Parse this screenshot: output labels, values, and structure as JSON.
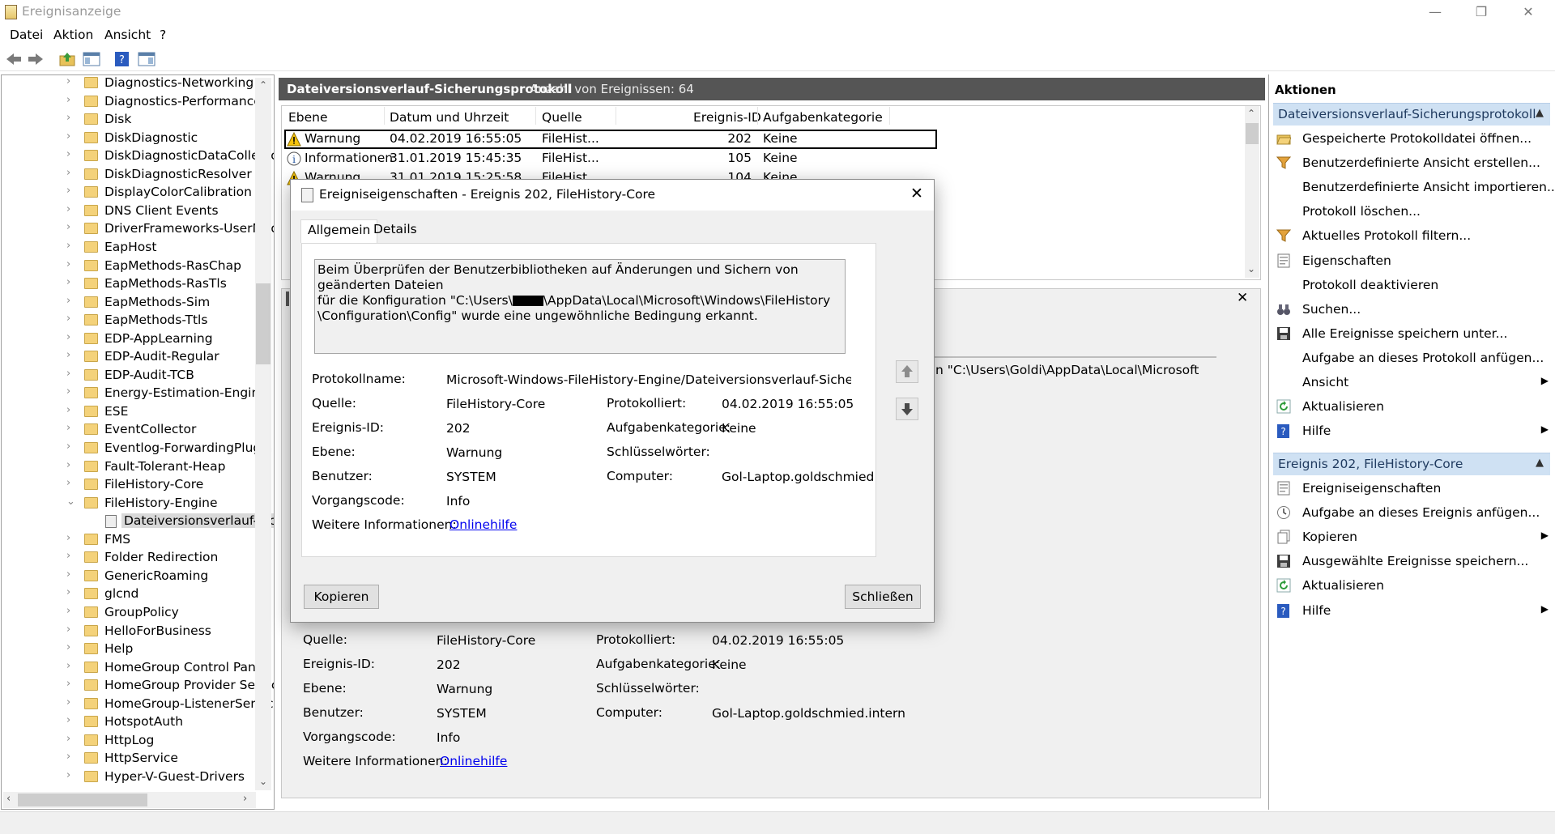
{
  "window": {
    "title": "Ereignisanzeige",
    "controls": {
      "minimize": "—",
      "restore": "❐",
      "close": "✕"
    }
  },
  "menu": [
    "Datei",
    "Aktion",
    "Ansicht",
    "?"
  ],
  "tree": {
    "items": [
      {
        "label": "Diagnostics-Networking",
        "chevron": "›"
      },
      {
        "label": "Diagnostics-Performance",
        "chevron": "›"
      },
      {
        "label": "Disk",
        "chevron": "›"
      },
      {
        "label": "DiskDiagnostic",
        "chevron": "›"
      },
      {
        "label": "DiskDiagnosticDataCollector",
        "chevron": "›"
      },
      {
        "label": "DiskDiagnosticResolver",
        "chevron": "›"
      },
      {
        "label": "DisplayColorCalibration",
        "chevron": "›"
      },
      {
        "label": "DNS Client Events",
        "chevron": "›"
      },
      {
        "label": "DriverFrameworks-UserMode",
        "chevron": "›"
      },
      {
        "label": "EapHost",
        "chevron": "›"
      },
      {
        "label": "EapMethods-RasChap",
        "chevron": "›"
      },
      {
        "label": "EapMethods-RasTls",
        "chevron": "›"
      },
      {
        "label": "EapMethods-Sim",
        "chevron": "›"
      },
      {
        "label": "EapMethods-Ttls",
        "chevron": "›"
      },
      {
        "label": "EDP-AppLearning",
        "chevron": "›"
      },
      {
        "label": "EDP-Audit-Regular",
        "chevron": "›"
      },
      {
        "label": "EDP-Audit-TCB",
        "chevron": "›"
      },
      {
        "label": "Energy-Estimation-Engine",
        "chevron": "›"
      },
      {
        "label": "ESE",
        "chevron": "›"
      },
      {
        "label": "EventCollector",
        "chevron": "›"
      },
      {
        "label": "Eventlog-ForwardingPlugin",
        "chevron": "›"
      },
      {
        "label": "Fault-Tolerant-Heap",
        "chevron": "›"
      },
      {
        "label": "FileHistory-Core",
        "chevron": "›"
      },
      {
        "label": "FileHistory-Engine",
        "chevron": "⌄"
      },
      {
        "label": "Dateiversionsverlauf-Sich",
        "chevron": ""
      },
      {
        "label": "FMS",
        "chevron": "›"
      },
      {
        "label": "Folder Redirection",
        "chevron": "›"
      },
      {
        "label": "GenericRoaming",
        "chevron": "›"
      },
      {
        "label": "glcnd",
        "chevron": "›"
      },
      {
        "label": "GroupPolicy",
        "chevron": "›"
      },
      {
        "label": "HelloForBusiness",
        "chevron": "›"
      },
      {
        "label": "Help",
        "chevron": "›"
      },
      {
        "label": "HomeGroup Control Panel",
        "chevron": "›"
      },
      {
        "label": "HomeGroup Provider Service",
        "chevron": "›"
      },
      {
        "label": "HomeGroup-ListenerService",
        "chevron": "›"
      },
      {
        "label": "HotspotAuth",
        "chevron": "›"
      },
      {
        "label": "HttpLog",
        "chevron": "›"
      },
      {
        "label": "HttpService",
        "chevron": "›"
      },
      {
        "label": "Hyper-V-Guest-Drivers",
        "chevron": "›"
      }
    ]
  },
  "log": {
    "title": "Dateiversionsverlauf-Sicherungsprotokoll",
    "count": "Anzahl von Ereignissen: 64",
    "columns": [
      "Ebene",
      "Datum und Uhrzeit",
      "Quelle",
      "Ereignis-ID",
      "Aufgabenkategorie"
    ],
    "rows": [
      {
        "level": "Warnung",
        "date": "04.02.2019 16:55:05",
        "source": "FileHist...",
        "id": "202",
        "category": "Keine"
      },
      {
        "level": "Informationen",
        "date": "31.01.2019 15:45:35",
        "source": "FileHist...",
        "id": "105",
        "category": "Keine"
      },
      {
        "level": "Warnung",
        "date": "31.01.2019 15:25:58",
        "source": "FileHist...",
        "id": "104",
        "category": "Keine"
      }
    ]
  },
  "preview": {
    "partial_text": "n \"C:\\Users\\Goldi\\AppData\\Local\\Microsoft",
    "labels": {
      "source": "Quelle:",
      "event_id": "Ereignis-ID:",
      "level": "Ebene:",
      "user": "Benutzer:",
      "opcode": "Vorgangscode:",
      "more_info": "Weitere Informationen:",
      "logged": "Protokolliert:",
      "task_category": "Aufgabenkategorie:",
      "keywords": "Schlüsselwörter:",
      "computer": "Computer:"
    },
    "values": {
      "source": "FileHistory-Core",
      "event_id": "202",
      "level": "Warnung",
      "user": "SYSTEM",
      "opcode": "Info",
      "more_info_link": "Onlinehilfe",
      "logged": "04.02.2019 16:55:05",
      "task_category": "Keine",
      "keywords": "",
      "computer": "Gol-Laptop.goldschmied.intern"
    }
  },
  "dialog": {
    "title": "Ereigniseigenschaften - Ereignis 202, FileHistory-Core",
    "tabs": [
      "Allgemein",
      "Details"
    ],
    "message_line1": "Beim Überprüfen der Benutzerbibliotheken auf Änderungen und Sichern von geänderten Dateien",
    "message_line2a": "für die Konfiguration \"C:\\Users\\",
    "message_line2b": "\\AppData\\Local\\Microsoft\\Windows\\FileHistory",
    "message_line3": "\\Configuration\\Config\" wurde eine ungewöhnliche Bedingung erkannt.",
    "labels": {
      "log_name": "Protokollname:",
      "source": "Quelle:",
      "event_id": "Ereignis-ID:",
      "level": "Ebene:",
      "user": "Benutzer:",
      "opcode": "Vorgangscode:",
      "more_info": "Weitere Informationen:",
      "logged": "Protokolliert:",
      "task_category": "Aufgabenkategorie:",
      "keywords": "Schlüsselwörter:",
      "computer": "Computer:"
    },
    "values": {
      "log_name": "Microsoft-Windows-FileHistory-Engine/Dateiversionsverlauf-Sicherungsproto",
      "source": "FileHistory-Core",
      "event_id": "202",
      "level": "Warnung",
      "user": "SYSTEM",
      "opcode": "Info",
      "more_info_link": "Onlinehilfe",
      "logged": "04.02.2019 16:55:05",
      "task_category": "Keine",
      "keywords": "",
      "computer": "Gol-Laptop.goldschmied"
    },
    "buttons": {
      "copy": "Kopieren",
      "close": "Schließen"
    }
  },
  "actions": {
    "title": "Aktionen",
    "section1": {
      "title": "Dateiversionsverlauf-Sicherungsprotokoll",
      "items": [
        {
          "label": "Gespeicherte Protokolldatei öffnen...",
          "icon": "folder-open-icon",
          "submenu": false
        },
        {
          "label": "Benutzerdefinierte Ansicht erstellen...",
          "icon": "filter-icon",
          "submenu": false
        },
        {
          "label": "Benutzerdefinierte Ansicht importieren...",
          "icon": "",
          "submenu": false
        },
        {
          "label": "Protokoll löschen...",
          "icon": "",
          "submenu": false
        },
        {
          "label": "Aktuelles Protokoll filtern...",
          "icon": "filter-icon",
          "submenu": false
        },
        {
          "label": "Eigenschaften",
          "icon": "properties-icon",
          "submenu": false
        },
        {
          "label": "Protokoll deaktivieren",
          "icon": "",
          "submenu": false
        },
        {
          "label": "Suchen...",
          "icon": "binoculars-icon",
          "submenu": false
        },
        {
          "label": "Alle Ereignisse speichern unter...",
          "icon": "save-icon",
          "submenu": false
        },
        {
          "label": "Aufgabe an dieses Protokoll anfügen...",
          "icon": "",
          "submenu": false
        },
        {
          "label": "Ansicht",
          "icon": "",
          "submenu": true
        },
        {
          "label": "Aktualisieren",
          "icon": "refresh-icon",
          "submenu": false
        },
        {
          "label": "Hilfe",
          "icon": "help-icon",
          "submenu": true
        }
      ]
    },
    "section2": {
      "title": "Ereignis 202, FileHistory-Core",
      "items": [
        {
          "label": "Ereigniseigenschaften",
          "icon": "properties-icon",
          "submenu": false
        },
        {
          "label": "Aufgabe an dieses Ereignis anfügen...",
          "icon": "task-icon",
          "submenu": false
        },
        {
          "label": "Kopieren",
          "icon": "copy-icon",
          "submenu": true
        },
        {
          "label": "Ausgewählte Ereignisse speichern...",
          "icon": "save-icon",
          "submenu": false
        },
        {
          "label": "Aktualisieren",
          "icon": "refresh-icon",
          "submenu": false
        },
        {
          "label": "Hilfe",
          "icon": "help-icon",
          "submenu": true
        }
      ]
    }
  }
}
